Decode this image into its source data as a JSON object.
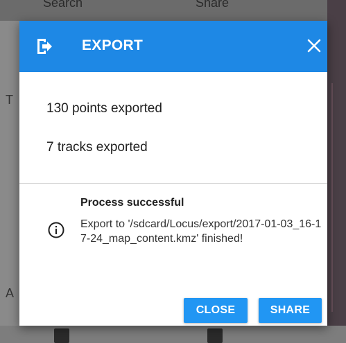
{
  "background": {
    "top_labels": [
      "Search",
      "Share"
    ],
    "side_letters": [
      "T",
      "A"
    ]
  },
  "dialog": {
    "title": "EXPORT",
    "header_icon": "export-icon",
    "close_icon": "close-icon",
    "lines": [
      "130 points exported",
      "7 tracks exported"
    ],
    "process_title": "Process successful",
    "process_icon": "info-icon",
    "process_message": "Export to '/sdcard/Locus/export/2017-01-03_16-17-24_map_content.kmz' finished!",
    "buttons": {
      "close": "CLOSE",
      "share": "SHARE"
    }
  },
  "colors": {
    "header": "#1e88e5",
    "button": "#2196f3"
  }
}
